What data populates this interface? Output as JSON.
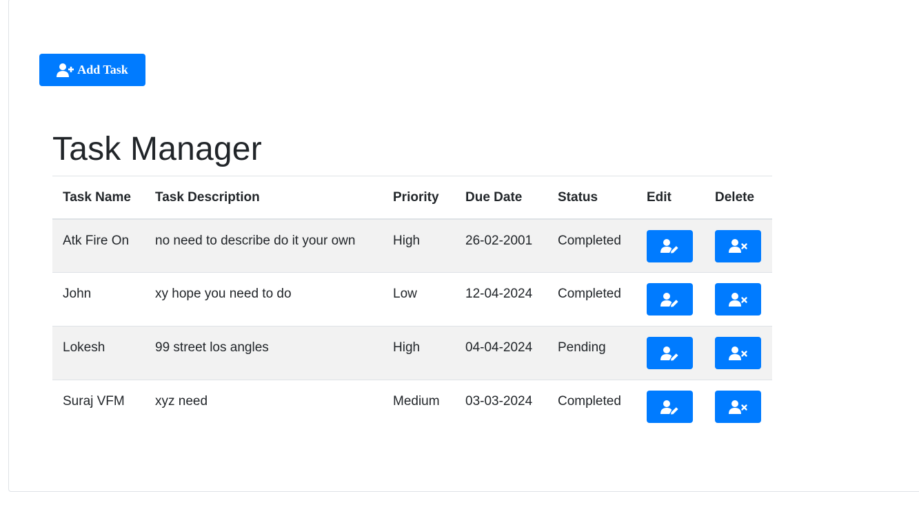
{
  "toolbar": {
    "add_task_label": "Add Task",
    "add_task_icon": "user-plus-icon"
  },
  "page": {
    "title": "Task Manager"
  },
  "table": {
    "headers": {
      "task_name": "Task Name",
      "task_description": "Task Description",
      "priority": "Priority",
      "due_date": "Due Date",
      "status": "Status",
      "edit": "Edit",
      "delete": "Delete"
    },
    "rows": [
      {
        "name": "Atk Fire On",
        "description": "no need to describe do it your own",
        "priority": "High",
        "due_date": "26-02-2001",
        "status": "Completed"
      },
      {
        "name": "John",
        "description": "xy hope you need to do",
        "priority": "Low",
        "due_date": "12-04-2024",
        "status": "Completed"
      },
      {
        "name": "Lokesh",
        "description": "99 street los angles",
        "priority": "High",
        "due_date": "04-04-2024",
        "status": "Pending"
      },
      {
        "name": "Suraj VFM",
        "description": "xyz need",
        "priority": "Medium",
        "due_date": "03-03-2024",
        "status": "Completed"
      }
    ],
    "edit_icon": "user-edit-icon",
    "delete_icon": "user-times-icon"
  },
  "colors": {
    "primary": "#007bff",
    "striped_row": "#f2f2f2",
    "border": "#dee2e6",
    "text": "#212529"
  }
}
